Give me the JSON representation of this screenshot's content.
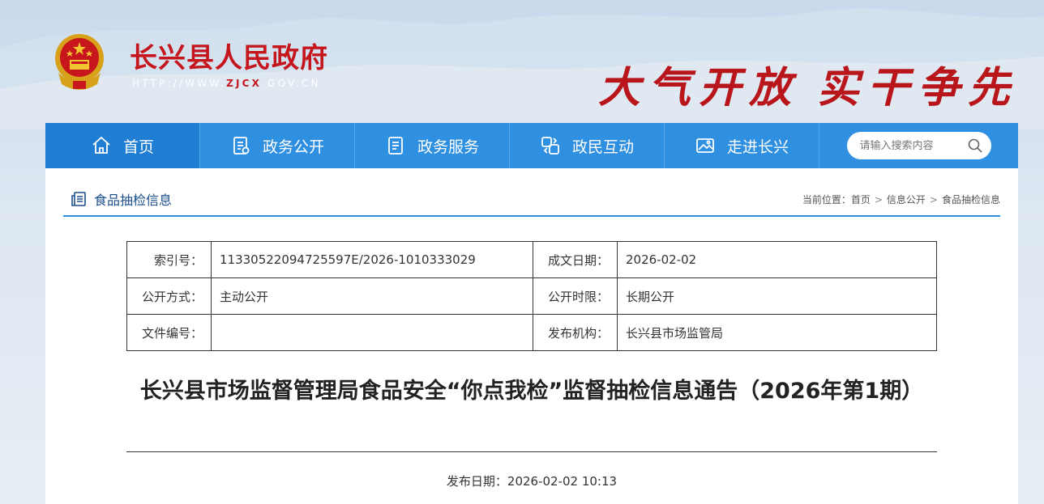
{
  "header": {
    "site_title": "长兴县人民政府",
    "site_url_prefix": "HTTP://WWW.",
    "site_url_highlight": "ZJCX",
    "site_url_suffix": ".GOV.CN",
    "slogan_part1": "大气开放",
    "slogan_part2": "实干争先"
  },
  "nav": {
    "items": [
      {
        "label": "首页",
        "icon": "home-icon"
      },
      {
        "label": "政务公开",
        "icon": "document-icon"
      },
      {
        "label": "政务服务",
        "icon": "service-icon"
      },
      {
        "label": "政民互动",
        "icon": "interaction-icon"
      },
      {
        "label": "走进长兴",
        "icon": "image-icon"
      }
    ],
    "search_placeholder": "请输入搜索内容"
  },
  "section": {
    "title": "食品抽检信息",
    "breadcrumb": [
      "当前位置：首页",
      "信息公开",
      "食品抽检信息"
    ]
  },
  "meta_table": {
    "rows": [
      [
        "索引号：",
        "11330522094725597E/2026-1010333029",
        "成文日期：",
        "2026-02-02"
      ],
      [
        "公开方式：",
        " 主动公开",
        "公开时限：",
        " 长期公开"
      ],
      [
        "文件编号：",
        "",
        "发布机构：",
        "长兴县市场监管局"
      ]
    ]
  },
  "article": {
    "title": "长兴县市场监督管理局食品安全“你点我检”监督抽检信息通告（2026年第1期）",
    "publish_date": "发布日期：2026-02-02 10:13"
  },
  "colors": {
    "brand_red": "#c4161c",
    "nav_blue": "#2f8fe0",
    "nav_active": "#1f7ed3"
  }
}
